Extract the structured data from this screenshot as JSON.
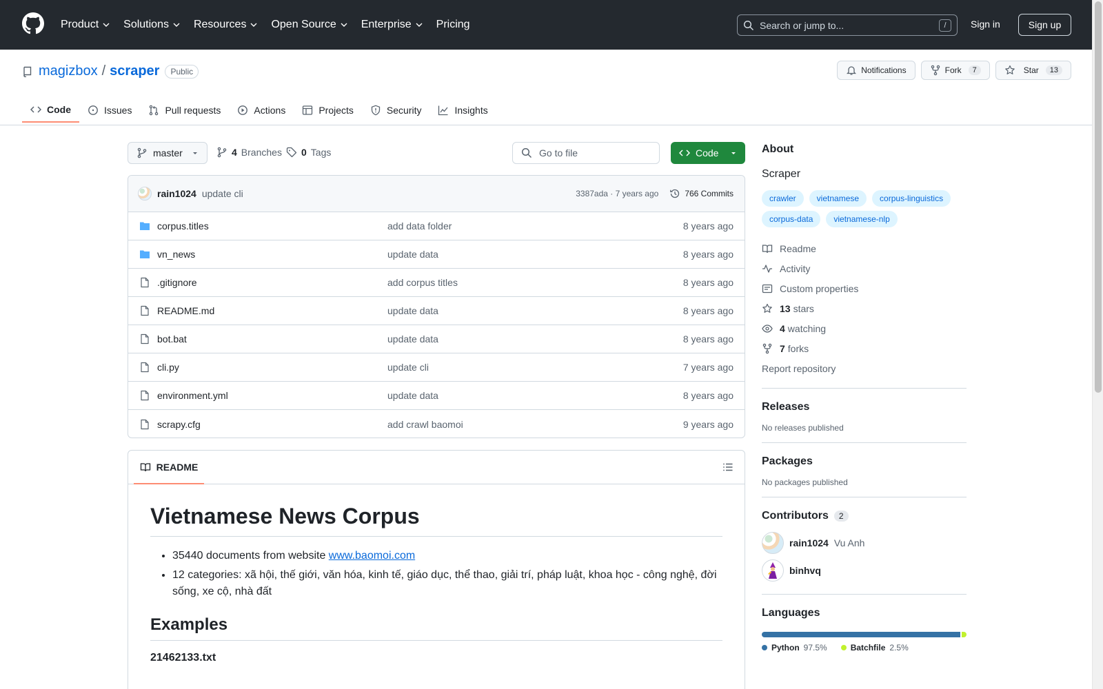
{
  "header": {
    "nav": [
      "Product",
      "Solutions",
      "Resources",
      "Open Source",
      "Enterprise",
      "Pricing"
    ],
    "search_placeholder": "Search or jump to...",
    "search_shortcut": "/",
    "sign_in": "Sign in",
    "sign_up": "Sign up"
  },
  "repo": {
    "owner": "magizbox",
    "separator": "/",
    "name": "scraper",
    "visibility": "Public",
    "notifications": "Notifications",
    "fork": "Fork",
    "fork_count": "7",
    "star": "Star",
    "star_count": "13"
  },
  "tabs": [
    "Code",
    "Issues",
    "Pull requests",
    "Actions",
    "Projects",
    "Security",
    "Insights"
  ],
  "toolbar": {
    "branch": "master",
    "branches_count": "4",
    "branches_label": "Branches",
    "tags_count": "0",
    "tags_label": "Tags",
    "goto_file": "Go to file",
    "code_button": "Code"
  },
  "latest_commit": {
    "author": "rain1024",
    "message": "update cli",
    "meta": "3387ada · 7 years ago",
    "commits": "766 Commits"
  },
  "files": [
    {
      "type": "dir",
      "name": "corpus.titles",
      "message": "add data folder",
      "date": "8 years ago"
    },
    {
      "type": "dir",
      "name": "vn_news",
      "message": "update data",
      "date": "8 years ago"
    },
    {
      "type": "file",
      "name": ".gitignore",
      "message": "add corpus titles",
      "date": "8 years ago"
    },
    {
      "type": "file",
      "name": "README.md",
      "message": "update data",
      "date": "8 years ago"
    },
    {
      "type": "file",
      "name": "bot.bat",
      "message": "update data",
      "date": "8 years ago"
    },
    {
      "type": "file",
      "name": "cli.py",
      "message": "update cli",
      "date": "7 years ago"
    },
    {
      "type": "file",
      "name": "environment.yml",
      "message": "update data",
      "date": "8 years ago"
    },
    {
      "type": "file",
      "name": "scrapy.cfg",
      "message": "add crawl baomoi",
      "date": "9 years ago"
    }
  ],
  "readme": {
    "tab": "README",
    "title": "Vietnamese News Corpus",
    "bullet1_prefix": "35440 documents from website ",
    "bullet1_link": "www.baomoi.com",
    "bullet2": "12 categories: xã hội, thế giới, văn hóa, kinh tế, giáo dục, thể thao, giải trí, pháp luật, khoa học - công nghệ, đời sống, xe cộ, nhà đất",
    "h2": "Examples",
    "h4": "21462133.txt"
  },
  "about": {
    "heading": "About",
    "description": "Scraper",
    "topics": [
      "crawler",
      "vietnamese",
      "corpus-linguistics",
      "corpus-data",
      "vietnamese-nlp"
    ],
    "readme": "Readme",
    "activity": "Activity",
    "custom_properties": "Custom properties",
    "stars_count": "13",
    "stars_label": "stars",
    "watching_count": "4",
    "watching_label": "watching",
    "forks_count": "7",
    "forks_label": "forks",
    "report": "Report repository"
  },
  "releases": {
    "heading": "Releases",
    "text": "No releases published"
  },
  "packages": {
    "heading": "Packages",
    "text": "No packages published"
  },
  "contributors": {
    "heading": "Contributors",
    "count": "2",
    "list": [
      {
        "login": "rain1024",
        "name": "Vu Anh"
      },
      {
        "login": "binhvq",
        "name": ""
      }
    ]
  },
  "languages": {
    "heading": "Languages",
    "list": [
      {
        "name": "Python",
        "percent": "97.5%",
        "value": 97.5,
        "color": "#3572A5"
      },
      {
        "name": "Batchfile",
        "percent": "2.5%",
        "value": 2.5,
        "color": "#C1F12E"
      }
    ]
  }
}
